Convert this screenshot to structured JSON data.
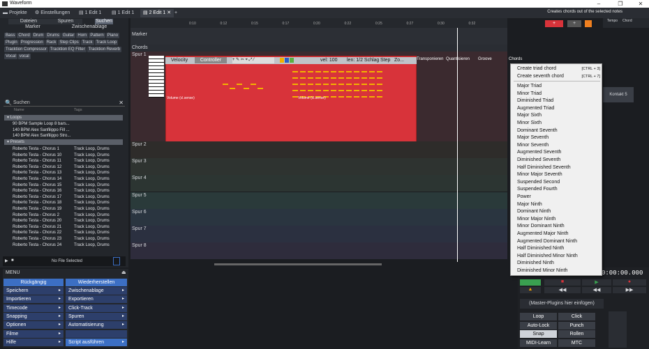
{
  "app": {
    "title": "Waveform",
    "hint": "Creates chords out of the selected notes"
  },
  "tabs": [
    {
      "label": "Projekte"
    },
    {
      "label": "Einstellungen"
    },
    {
      "label": "1 Edit 1"
    },
    {
      "label": "1 Edit 1"
    },
    {
      "label": "2 Edit 1"
    },
    {
      "label": "+"
    }
  ],
  "left": {
    "top_tabs": [
      "Dateien",
      "Spuren",
      "Suchen"
    ],
    "sub_tabs": [
      "Marker",
      "Zwischenablage"
    ],
    "tags": [
      "Bass",
      "Chord",
      "Drum",
      "Drums",
      "Guitar",
      "Horn",
      "Pattern",
      "Piano",
      "Plugin",
      "Progression",
      "Rack",
      "Step Clips",
      "Track",
      "Track Loop",
      "Tracktion Compressor",
      "Tracktion EQ Filter",
      "Tracktion Reverb",
      "Vocal",
      "vocal"
    ],
    "search_placeholder": "Suchen",
    "col_name": "Name",
    "col_tags": "Tags",
    "group_loops": "Loops",
    "loops": [
      "90 BPM Sample Loop 8 bars...",
      "140 BPM Alex Sanfilippo Fill ...",
      "140 BPM Alex Sanfilippo Stro..."
    ],
    "group_presets": "Presets",
    "presets": [
      {
        "name": "Roberto Testa - Chorus 1",
        "tags": "Track Loop, Drums"
      },
      {
        "name": "Roberto Testa - Chorus 10",
        "tags": "Track Loop, Drums"
      },
      {
        "name": "Roberto Testa - Chorus 11",
        "tags": "Track Loop, Drums"
      },
      {
        "name": "Roberto Testa - Chorus 12",
        "tags": "Track Loop, Drums"
      },
      {
        "name": "Roberto Testa - Chorus 13",
        "tags": "Track Loop, Drums"
      },
      {
        "name": "Roberto Testa - Chorus 14",
        "tags": "Track Loop, Drums"
      },
      {
        "name": "Roberto Testa - Chorus 15",
        "tags": "Track Loop, Drums"
      },
      {
        "name": "Roberto Testa - Chorus 16",
        "tags": "Track Loop, Drums"
      },
      {
        "name": "Roberto Testa - Chorus 17",
        "tags": "Track Loop, Drums"
      },
      {
        "name": "Roberto Testa - Chorus 18",
        "tags": "Track Loop, Drums"
      },
      {
        "name": "Roberto Testa - Chorus 19",
        "tags": "Track Loop, Drums"
      },
      {
        "name": "Roberto Testa - Chorus 2",
        "tags": "Track Loop, Drums"
      },
      {
        "name": "Roberto Testa - Chorus 20",
        "tags": "Track Loop, Drums"
      },
      {
        "name": "Roberto Testa - Chorus 21",
        "tags": "Track Loop, Drums"
      },
      {
        "name": "Roberto Testa - Chorus 22",
        "tags": "Track Loop, Drums"
      },
      {
        "name": "Roberto Testa - Chorus 23",
        "tags": "Track Loop, Drums"
      },
      {
        "name": "Roberto Testa - Chorus 24",
        "tags": "Track Loop, Drums"
      }
    ],
    "no_file": "No File Selected"
  },
  "menu": {
    "title": "MENU",
    "undo": "Rückgängig",
    "redo": "Wiederherstellen",
    "left_items": [
      "Speichern",
      "Importieren",
      "Timecode",
      "Snapping",
      "Optionen",
      "Filme",
      "Hilfe"
    ],
    "right_items": [
      "Zwischenablage",
      "Exportieren",
      "Click-Track",
      "Spuren",
      "Automatisierung",
      "",
      "Script ausführen"
    ]
  },
  "ruler": {
    "ticks": [
      "0:10",
      "0:12",
      "0:15",
      "0:17",
      "0:20",
      "0:22",
      "0:25",
      "0:27",
      "0:30",
      "0:32"
    ]
  },
  "rows": {
    "marker": "Marker",
    "chords": "Chords"
  },
  "tracks": [
    "Spur 1",
    "Spur 2",
    "Spur 3",
    "Spur 4",
    "Spur 5",
    "Spur 6",
    "Spur 7",
    "Spur 8"
  ],
  "editor": {
    "velocity": "Velocity",
    "controller": "Controller",
    "vel": "vel: 100",
    "len": "len: 1/2 Schlag",
    "step": "Step",
    "zoom": "Zo...",
    "transpose": "Transponieren",
    "quantize": "Quantisieren",
    "groove": "Groove",
    "chords": "Chords",
    "volume": "Volume (cl.sense)"
  },
  "context_menu": {
    "top": [
      {
        "label": "Create triad chord",
        "shortcut": "[CTRL + 3]"
      },
      {
        "label": "Create seventh chord",
        "shortcut": "[CTRL + 7]"
      }
    ],
    "items": [
      "Major Triad",
      "Minor Triad",
      "Diminished Triad",
      "Augmented Triad",
      "Major Sixth",
      "Minor Sixth",
      "Dominant Seventh",
      "Major Seventh",
      "Minor Seventh",
      "Augmented Seventh",
      "Diminished Seventh",
      "Half Diminished Seventh",
      "Minor Major Seventh",
      "Suspended Second",
      "Suspended Fourth",
      "Power",
      "Major Ninth",
      "Dominant Ninth",
      "Minor Major Ninth",
      "Minor Dominant Ninth",
      "Augmented Major Ninth",
      "Augmented Dominant Ninth",
      "Half Diminished Ninth",
      "Half Diminished Minor Ninth",
      "Diminished Ninth",
      "Diminished Minor Ninth"
    ]
  },
  "right": {
    "tempo": "Tempo",
    "chord": "Chord",
    "kontakt": "Kontakt 5",
    "time": "0:00:00.000",
    "master": "(Master-Plugins hier einfügen)",
    "buttons": [
      [
        "Loop",
        "Click"
      ],
      [
        "Auto-Lock",
        "Punch"
      ],
      [
        "Snap",
        "Rollen"
      ],
      [
        "MIDI-Learn",
        "MTC"
      ]
    ]
  },
  "colors": {
    "accent": "#3c6fc4",
    "clip": "#d8333a",
    "menu_bg": "#f0f0f0"
  }
}
